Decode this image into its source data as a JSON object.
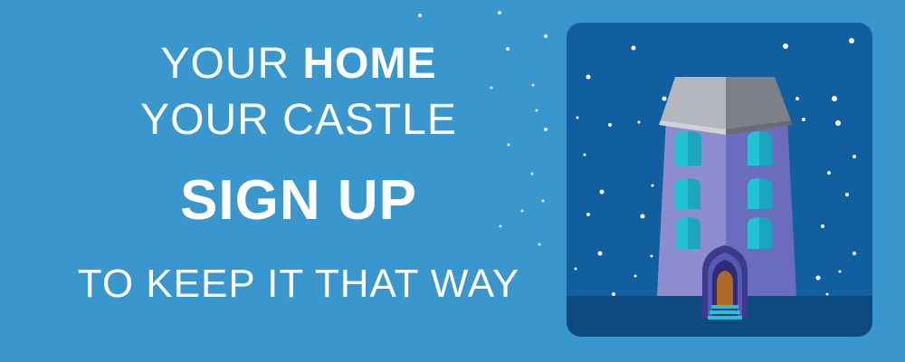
{
  "headline": {
    "line1_light": "YOUR",
    "line1_bold": "HOME",
    "line2": "YOUR CASTLE",
    "cta": "SIGN UP",
    "tagline": "TO KEEP IT THAT WAY"
  },
  "colors": {
    "background": "#3a97cd",
    "panel": "#125fa0",
    "panel_ground": "#0d4a80",
    "tower_left": "#8c8ccf",
    "tower_right": "#6c6cbe",
    "roof_left": "#b5b7be",
    "roof_right": "#7e8088",
    "window": "#22c3d6",
    "door": "#b06a26",
    "text": "#ffffff"
  },
  "illustration": {
    "icon": "castle-tower-icon"
  }
}
